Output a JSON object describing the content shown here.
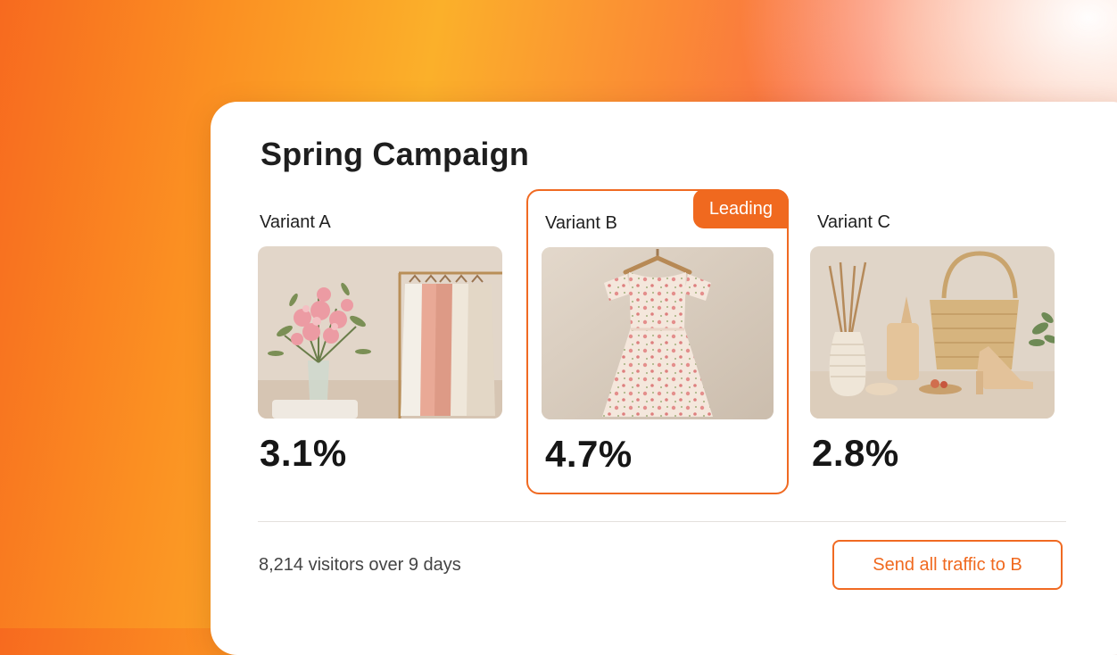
{
  "campaign": {
    "title": "Spring Campaign"
  },
  "variants": [
    {
      "label": "Variant A",
      "conversion_rate": "3.1%",
      "image": "flowers-and-clothing-rack-image"
    },
    {
      "label": "Variant B",
      "conversion_rate": "4.7%",
      "image": "floral-dress-on-hanger-image",
      "badge": "Leading"
    },
    {
      "label": "Variant C",
      "conversion_rate": "2.8%",
      "image": "vase-basket-bag-sandals-image"
    }
  ],
  "footer": {
    "visitors_text": "8,214 visitors over 9 days",
    "cta_label": "Send all traffic to B"
  },
  "colors": {
    "accent": "#f0691f",
    "card_background": "#ffffff",
    "text_primary": "#1e1e1e"
  }
}
